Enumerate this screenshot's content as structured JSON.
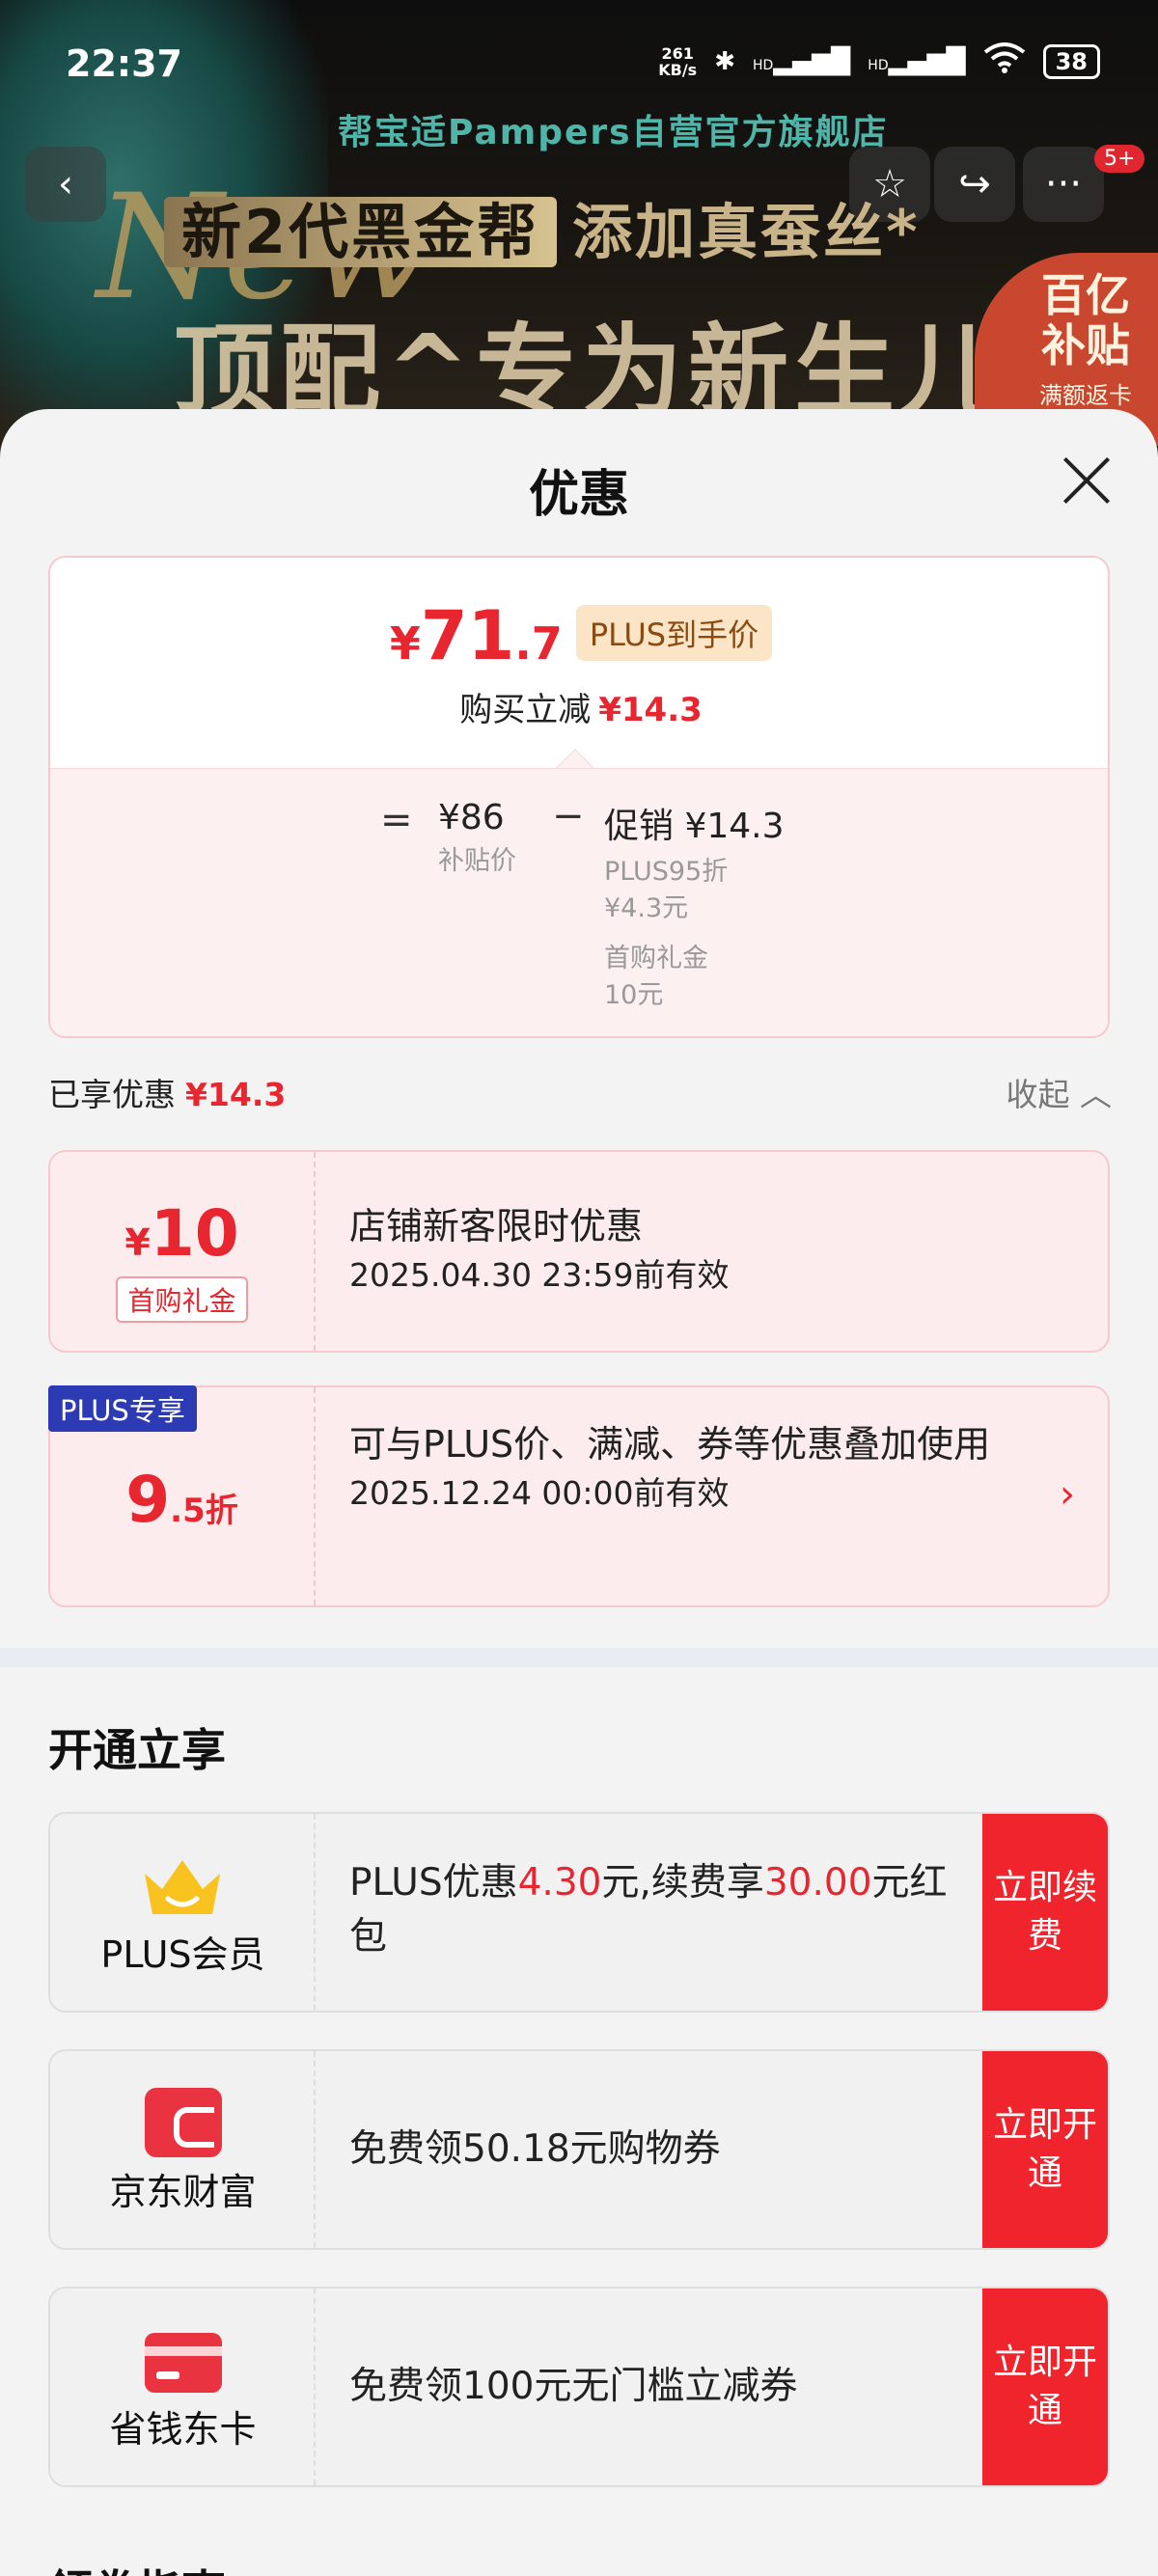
{
  "status_bar": {
    "time": "22:37",
    "speed_value": "261",
    "speed_unit": "KB/s",
    "network_1": "HD",
    "network_2": "HD",
    "battery": "38"
  },
  "banner": {
    "store_name": "帮宝适Pampers自营官方旗舰店",
    "script_text": "New",
    "tag_text": "新2代黑金帮",
    "line1_text": "添加真蚕丝*",
    "line2_text": "顶配^专为新生儿",
    "subsidy_line1": "百亿",
    "subsidy_line2": "补贴",
    "subsidy_line3": "满额返卡",
    "message_badge": "5+",
    "icons": {
      "back": "chevron-left-icon",
      "star": "star-icon",
      "share": "share-icon",
      "more": "more-icon"
    }
  },
  "sheet": {
    "title": "优惠",
    "price": {
      "currency": "¥",
      "integer": "71",
      "decimal": ".7",
      "plus_tag": "PLUS到手价",
      "buy_reduce_label": "购买立减",
      "buy_reduce_amount": "¥14.3"
    },
    "breakdown": {
      "equals": "=",
      "base_value": "¥86",
      "base_label": "补贴价",
      "minus": "−",
      "promo_value": "促销 ¥14.3",
      "promo_detail_1": "PLUS95折",
      "promo_detail_1_amt": "¥4.3元",
      "promo_detail_2": "首购礼金",
      "promo_detail_2_amt": "10元"
    },
    "enjoyed_label": "已享优惠",
    "enjoyed_amount": "¥14.3",
    "collapse_label": "收起",
    "coupons": [
      {
        "currency": "¥",
        "amount": "10",
        "tag": "首购礼金",
        "title": "店铺新客限时优惠",
        "validity": "2025.04.30 23:59前有效"
      },
      {
        "badge": "PLUS专享",
        "discount_int": "9",
        "discount_suffix": ".5折",
        "title": "可与PLUS价、满减、券等优惠叠加使用",
        "validity": "2025.12.24 00:00前有效"
      }
    ],
    "open_section_title": "开通立享",
    "services": [
      {
        "name": "PLUS会员",
        "desc_prefix": "PLUS优惠",
        "desc_amount_1": "4.30",
        "desc_mid": "元,续费享",
        "desc_amount_2": "30.00",
        "desc_suffix": "元红包",
        "cta": "立即续费",
        "icon": "crown-icon"
      },
      {
        "name": "京东财富",
        "desc": "免费领50.18元购物券",
        "cta": "立即开通",
        "icon": "wallet-icon"
      },
      {
        "name": "省钱东卡",
        "desc": "免费领100元无门槛立减券",
        "cta": "立即开通",
        "icon": "card-icon"
      }
    ],
    "next_section_title": "領卷指南",
    "colors": {
      "accent_red": "#e8262f",
      "plus_blue": "#2c3bb3",
      "cta_red": "#f0242d"
    }
  }
}
